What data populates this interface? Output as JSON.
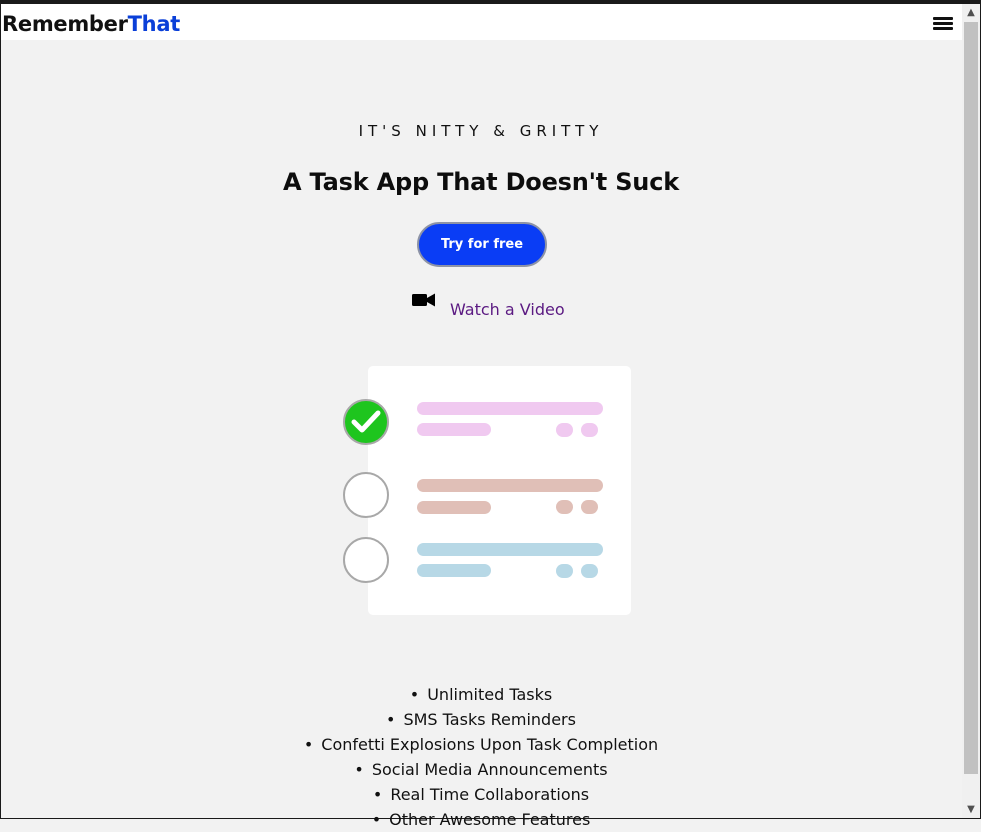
{
  "header": {
    "logo_primary": "Remember",
    "logo_accent": "That",
    "accent_color": "#0a3fd8",
    "menu_icon": "hamburger-icon"
  },
  "hero": {
    "eyebrow": "IT'S NITTY & GRITTY",
    "headline": "A Task App That Doesn't Suck",
    "cta_label": "Try for free",
    "cta_color": "#0a3df5",
    "video_icon": "video-camera-icon",
    "video_label": "Watch a Video"
  },
  "illustration": {
    "tasks": [
      {
        "status": "done",
        "color": "#f0c9f0"
      },
      {
        "status": "open",
        "color": "#e0bfb7"
      },
      {
        "status": "open",
        "color": "#b7d8e6"
      }
    ]
  },
  "features": [
    "Unlimited Tasks",
    "SMS Tasks Reminders",
    "Confetti Explosions Upon Task Completion",
    "Social Media Announcements",
    "Real Time Collaborations",
    "Other Awesome Features"
  ]
}
